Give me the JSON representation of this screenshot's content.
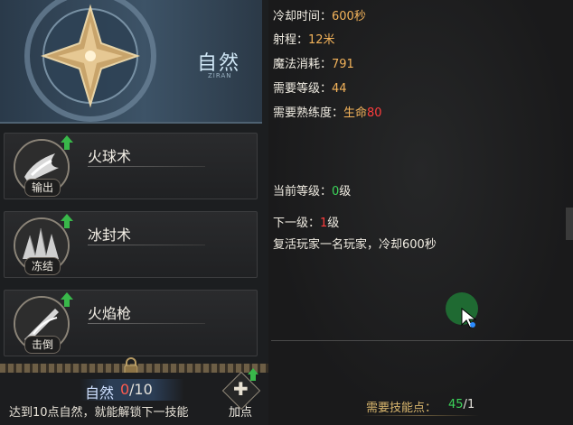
{
  "banner": {
    "title": "自然",
    "subtitle": "ZIRAN"
  },
  "skills": [
    {
      "name": "火球术",
      "tag": "输出"
    },
    {
      "name": "冰封术",
      "tag": "冻结"
    },
    {
      "name": "火焰枪",
      "tag": "击倒"
    }
  ],
  "points": {
    "label": "自然",
    "current": "0",
    "max": "/10"
  },
  "unlock_hint": "达到10点自然，就能解锁下一技能",
  "add_button": {
    "label": "加点"
  },
  "details": {
    "cooldown_label": "冷却时间：",
    "cooldown_value": "600秒",
    "range_label": "射程：",
    "range_value": "12米",
    "mana_label": "魔法消耗：",
    "mana_value": "791",
    "level_req_label": "需要等级：",
    "level_req_value": "44",
    "prof_label": "需要熟练度：",
    "prof_name": "生命",
    "prof_value": "80",
    "current_label": "当前等级：",
    "current_value": "0",
    "current_unit": "级",
    "next_label": "下一级：",
    "next_value": "1",
    "next_unit": "级",
    "next_desc": "复活玩家一名玩家，冷却600秒"
  },
  "required_points": {
    "label": "需要技能点：",
    "current": "45",
    "sep": "/",
    "max": "1"
  },
  "colors": {
    "accent_gold": "#f3b35a",
    "green": "#3cd45a",
    "red": "#ff3d3d",
    "banner_blue": "#3d5367"
  },
  "icons": [
    "up-arrow-icon",
    "lock-icon",
    "plus-icon",
    "cursor-icon",
    "fireball-icon",
    "ice-icon",
    "fire-spear-icon",
    "cross-emblem-icon"
  ]
}
